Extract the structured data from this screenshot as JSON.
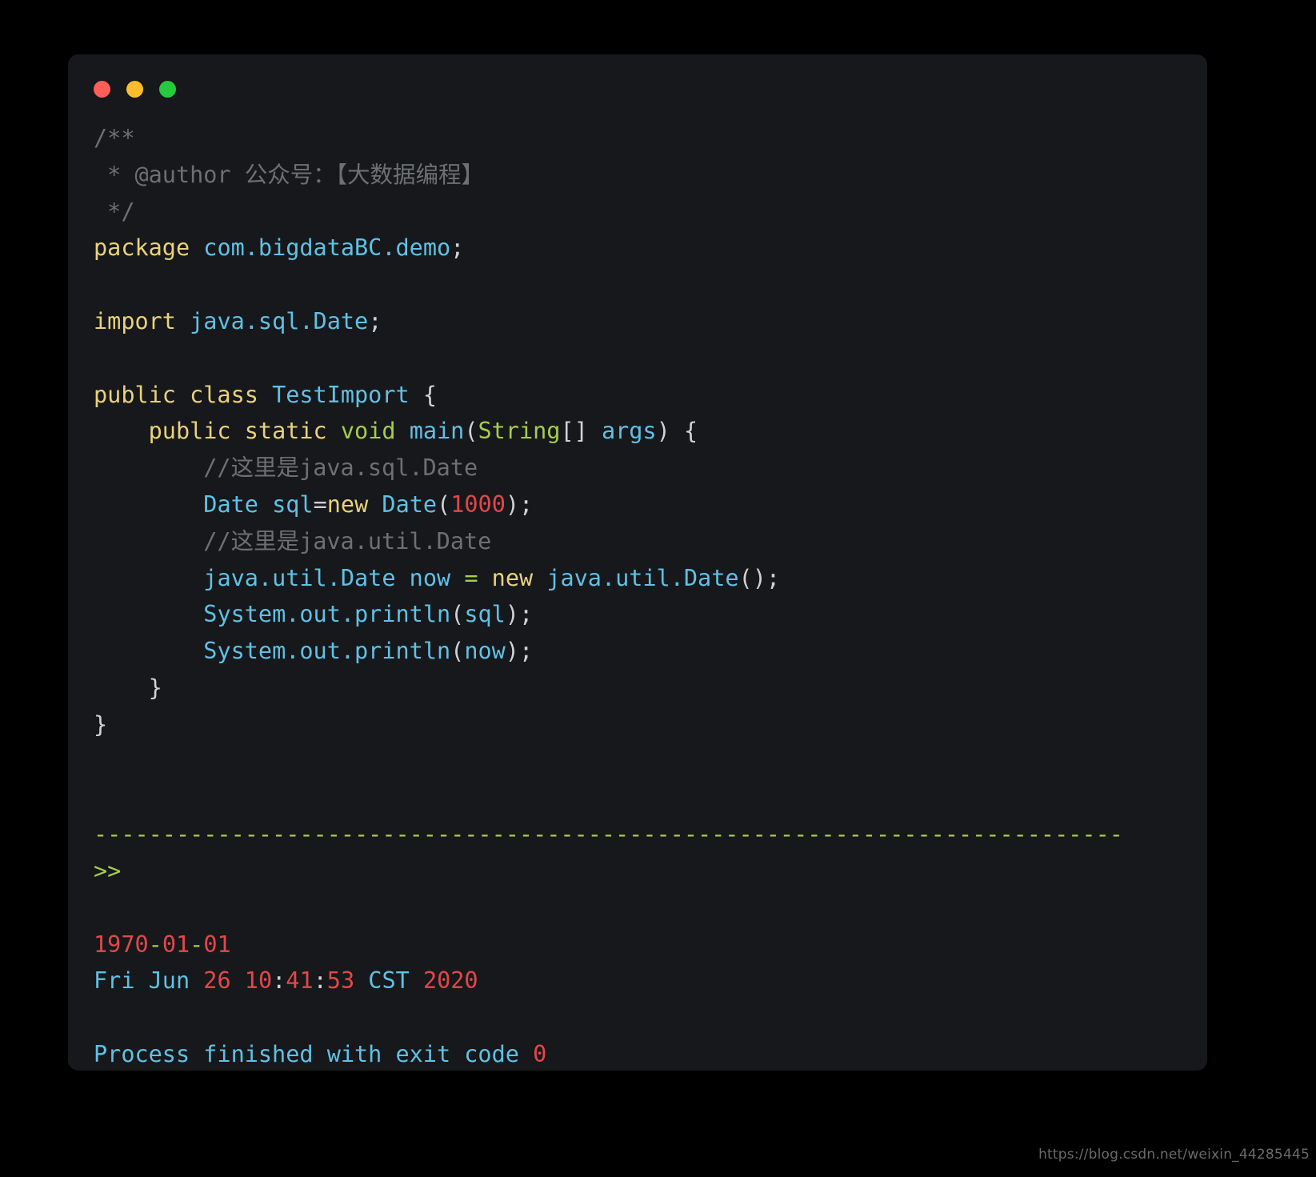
{
  "window": {
    "controls": [
      {
        "name": "close",
        "color": "#ff5f56"
      },
      {
        "name": "minimize",
        "color": "#ffbd2e"
      },
      {
        "name": "maximize",
        "color": "#27c93f"
      }
    ]
  },
  "editor": {
    "language": "java",
    "theme_background": "#17181b",
    "page_background": "#000000",
    "colors": {
      "comment": "#6b7075",
      "keyword": "#e9d27b",
      "type": "#5fc1e6",
      "green": "#a5cd4e",
      "punctuation": "#cfd2d4",
      "number": "#e2474a"
    },
    "code_lines": [
      {
        "id": "l1",
        "tokens": [
          {
            "t": "/**",
            "c": "comment"
          }
        ]
      },
      {
        "id": "l2",
        "tokens": [
          {
            "t": " * @author 公众号：【大数据编程】",
            "c": "comment"
          }
        ]
      },
      {
        "id": "l3",
        "tokens": [
          {
            "t": " */",
            "c": "comment"
          }
        ]
      },
      {
        "id": "l4",
        "tokens": [
          {
            "t": "package",
            "c": "keyword"
          },
          {
            "t": " ",
            "c": "plain"
          },
          {
            "t": "com.bigdataBC.demo",
            "c": "type"
          },
          {
            "t": ";",
            "c": "plain"
          }
        ]
      },
      {
        "id": "l5",
        "tokens": []
      },
      {
        "id": "l6",
        "tokens": [
          {
            "t": "import",
            "c": "keyword"
          },
          {
            "t": " ",
            "c": "plain"
          },
          {
            "t": "java.sql.Date",
            "c": "type"
          },
          {
            "t": ";",
            "c": "plain"
          }
        ]
      },
      {
        "id": "l7",
        "tokens": []
      },
      {
        "id": "l8",
        "tokens": [
          {
            "t": "public class",
            "c": "keyword"
          },
          {
            "t": " ",
            "c": "plain"
          },
          {
            "t": "TestImport",
            "c": "type"
          },
          {
            "t": " {",
            "c": "plain"
          }
        ]
      },
      {
        "id": "l9",
        "tokens": [
          {
            "t": "    ",
            "c": "plain"
          },
          {
            "t": "public static",
            "c": "keyword"
          },
          {
            "t": " ",
            "c": "plain"
          },
          {
            "t": "void",
            "c": "green"
          },
          {
            "t": " ",
            "c": "plain"
          },
          {
            "t": "main",
            "c": "type"
          },
          {
            "t": "(",
            "c": "plain"
          },
          {
            "t": "String",
            "c": "green"
          },
          {
            "t": "[] ",
            "c": "plain"
          },
          {
            "t": "args",
            "c": "type"
          },
          {
            "t": ") {",
            "c": "plain"
          }
        ]
      },
      {
        "id": "l10",
        "tokens": [
          {
            "t": "        //这里是java.sql.Date",
            "c": "comment"
          }
        ]
      },
      {
        "id": "l11",
        "tokens": [
          {
            "t": "        ",
            "c": "plain"
          },
          {
            "t": "Date",
            "c": "type"
          },
          {
            "t": " ",
            "c": "plain"
          },
          {
            "t": "sql",
            "c": "type"
          },
          {
            "t": "=",
            "c": "plain"
          },
          {
            "t": "new",
            "c": "keyword"
          },
          {
            "t": " ",
            "c": "plain"
          },
          {
            "t": "Date",
            "c": "type"
          },
          {
            "t": "(",
            "c": "plain"
          },
          {
            "t": "1000",
            "c": "number"
          },
          {
            "t": ");",
            "c": "plain"
          }
        ]
      },
      {
        "id": "l12",
        "tokens": [
          {
            "t": "        //这里是java.util.Date",
            "c": "comment"
          }
        ]
      },
      {
        "id": "l13",
        "tokens": [
          {
            "t": "        ",
            "c": "plain"
          },
          {
            "t": "java.util.Date now",
            "c": "type"
          },
          {
            "t": " ",
            "c": "plain"
          },
          {
            "t": "=",
            "c": "green"
          },
          {
            "t": " ",
            "c": "plain"
          },
          {
            "t": "new",
            "c": "keyword"
          },
          {
            "t": " ",
            "c": "plain"
          },
          {
            "t": "java.util.Date",
            "c": "type"
          },
          {
            "t": "();",
            "c": "plain"
          }
        ]
      },
      {
        "id": "l14",
        "tokens": [
          {
            "t": "        ",
            "c": "plain"
          },
          {
            "t": "System.out.println",
            "c": "type"
          },
          {
            "t": "(",
            "c": "plain"
          },
          {
            "t": "sql",
            "c": "type"
          },
          {
            "t": ");",
            "c": "plain"
          }
        ]
      },
      {
        "id": "l15",
        "tokens": [
          {
            "t": "        ",
            "c": "plain"
          },
          {
            "t": "System.out.println",
            "c": "type"
          },
          {
            "t": "(",
            "c": "plain"
          },
          {
            "t": "now",
            "c": "type"
          },
          {
            "t": ");",
            "c": "plain"
          }
        ]
      },
      {
        "id": "l16",
        "tokens": [
          {
            "t": "    }",
            "c": "plain"
          }
        ]
      },
      {
        "id": "l17",
        "tokens": [
          {
            "t": "}",
            "c": "plain"
          }
        ]
      },
      {
        "id": "l18",
        "tokens": []
      },
      {
        "id": "l19",
        "tokens": []
      },
      {
        "id": "l20",
        "tokens": [
          {
            "t": "---------------------------------------------------------------------------",
            "c": "green"
          }
        ]
      },
      {
        "id": "l21",
        "tokens": [
          {
            "t": ">>",
            "c": "green"
          }
        ]
      },
      {
        "id": "l22",
        "tokens": []
      },
      {
        "id": "l23",
        "tokens": [
          {
            "t": "1970",
            "c": "number"
          },
          {
            "t": "-",
            "c": "green"
          },
          {
            "t": "01",
            "c": "number"
          },
          {
            "t": "-",
            "c": "green"
          },
          {
            "t": "01",
            "c": "number"
          }
        ]
      },
      {
        "id": "l24",
        "tokens": [
          {
            "t": "Fri Jun",
            "c": "type"
          },
          {
            "t": " ",
            "c": "plain"
          },
          {
            "t": "26",
            "c": "number"
          },
          {
            "t": " ",
            "c": "plain"
          },
          {
            "t": "10",
            "c": "number"
          },
          {
            "t": ":",
            "c": "plain"
          },
          {
            "t": "41",
            "c": "number"
          },
          {
            "t": ":",
            "c": "plain"
          },
          {
            "t": "53",
            "c": "number"
          },
          {
            "t": " ",
            "c": "plain"
          },
          {
            "t": "CST",
            "c": "type"
          },
          {
            "t": " ",
            "c": "plain"
          },
          {
            "t": "2020",
            "c": "number"
          }
        ]
      },
      {
        "id": "l25",
        "tokens": []
      },
      {
        "id": "l26",
        "tokens": [
          {
            "t": "Process finished with exit code",
            "c": "type"
          },
          {
            "t": " ",
            "c": "plain"
          },
          {
            "t": "0",
            "c": "number"
          }
        ]
      }
    ]
  },
  "watermark": {
    "text": "https://blog.csdn.net/weixin_44285445"
  }
}
